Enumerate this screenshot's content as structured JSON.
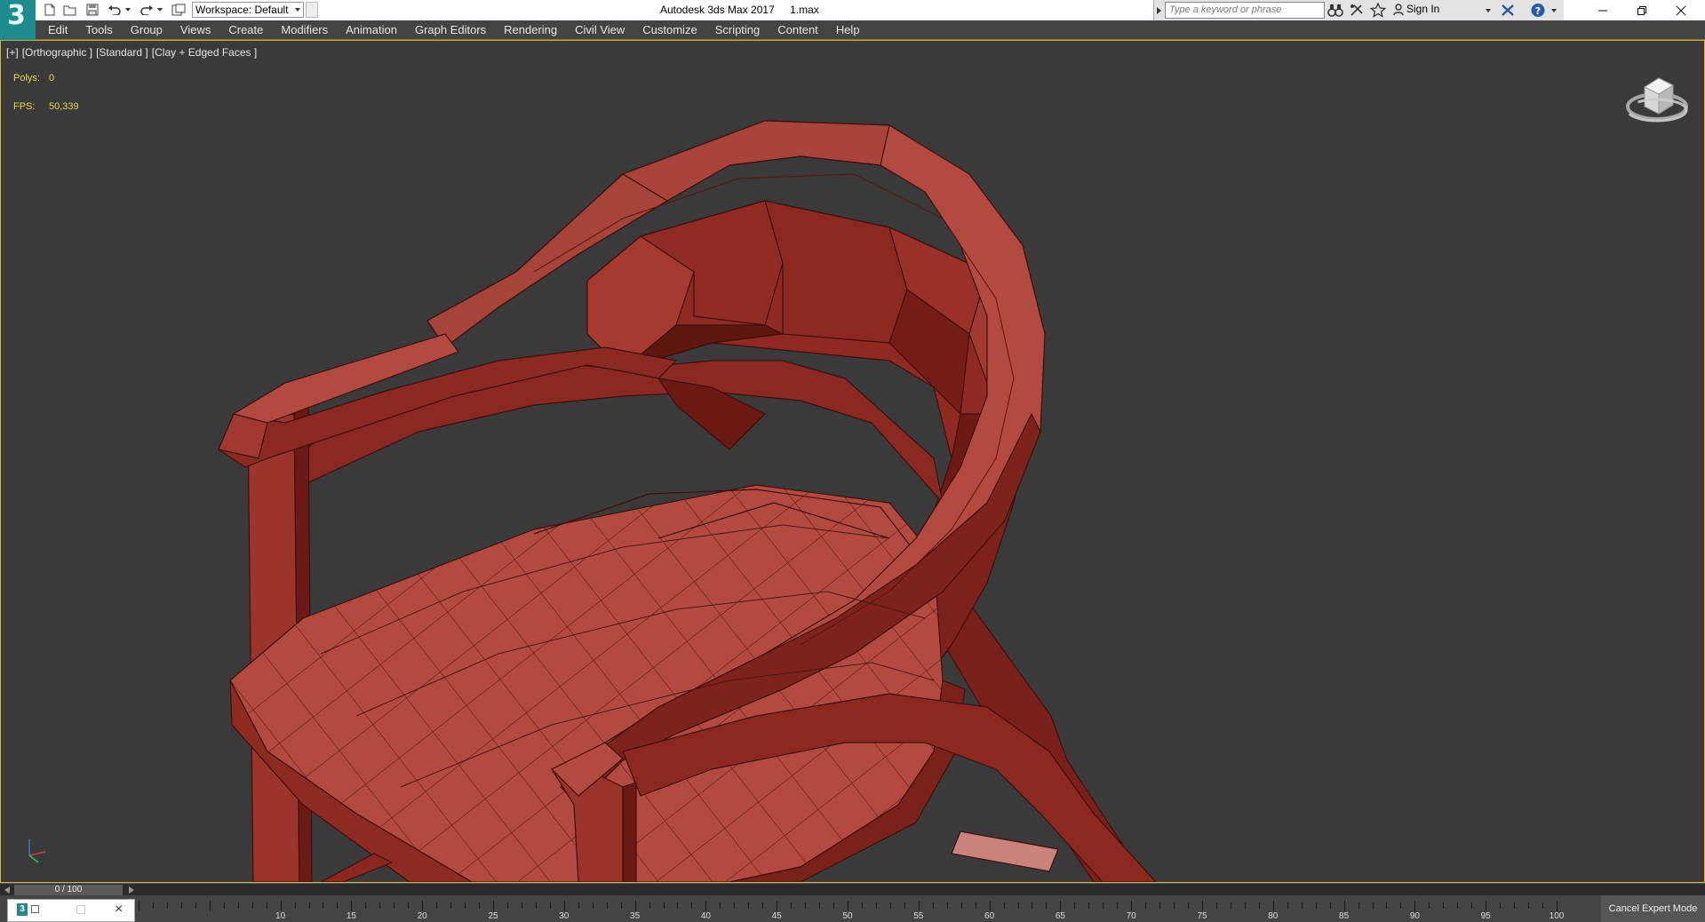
{
  "titlebar": {
    "app_name": "Autodesk 3ds Max 2017",
    "file_name": "1.max",
    "workspace_label": "Workspace: Default",
    "search_placeholder": "Type a keyword or phrase",
    "sign_in": "Sign In",
    "icons": [
      "new-file-icon",
      "open-file-icon",
      "save-icon",
      "undo-icon",
      "redo-icon",
      "project-folder-icon",
      "binoculars-icon",
      "communication-center-icon",
      "favorites-star-icon",
      "user-icon",
      "autodesk-exchange-icon",
      "help-icon",
      "minimize-icon",
      "restore-icon",
      "close-icon"
    ]
  },
  "menu": [
    "Edit",
    "Tools",
    "Group",
    "Views",
    "Create",
    "Modifiers",
    "Animation",
    "Graph Editors",
    "Rendering",
    "Civil View",
    "Customize",
    "Scripting",
    "Content",
    "Help"
  ],
  "viewport": {
    "label_plus": "[+]",
    "label_view": "[Orthographic ]",
    "label_shading_std": "[Standard ]",
    "label_shading": "[Clay + Edged Faces ]",
    "stats": {
      "polys_label": "Polys:",
      "polys_value": "0",
      "fps_label": "FPS:",
      "fps_value": "50,339"
    },
    "object_color": "#b24a3f",
    "background_color": "#3a3a3a",
    "highlight_border_color": "#d9b33a"
  },
  "timeline": {
    "slider_text": "0 / 100",
    "ticks": [
      "10",
      "15",
      "20",
      "25",
      "30",
      "35",
      "40",
      "45",
      "50",
      "55",
      "60",
      "65",
      "70",
      "75",
      "80",
      "85",
      "90",
      "95",
      "100"
    ],
    "cancel_expert_mode": "Cancel Expert Mode"
  }
}
